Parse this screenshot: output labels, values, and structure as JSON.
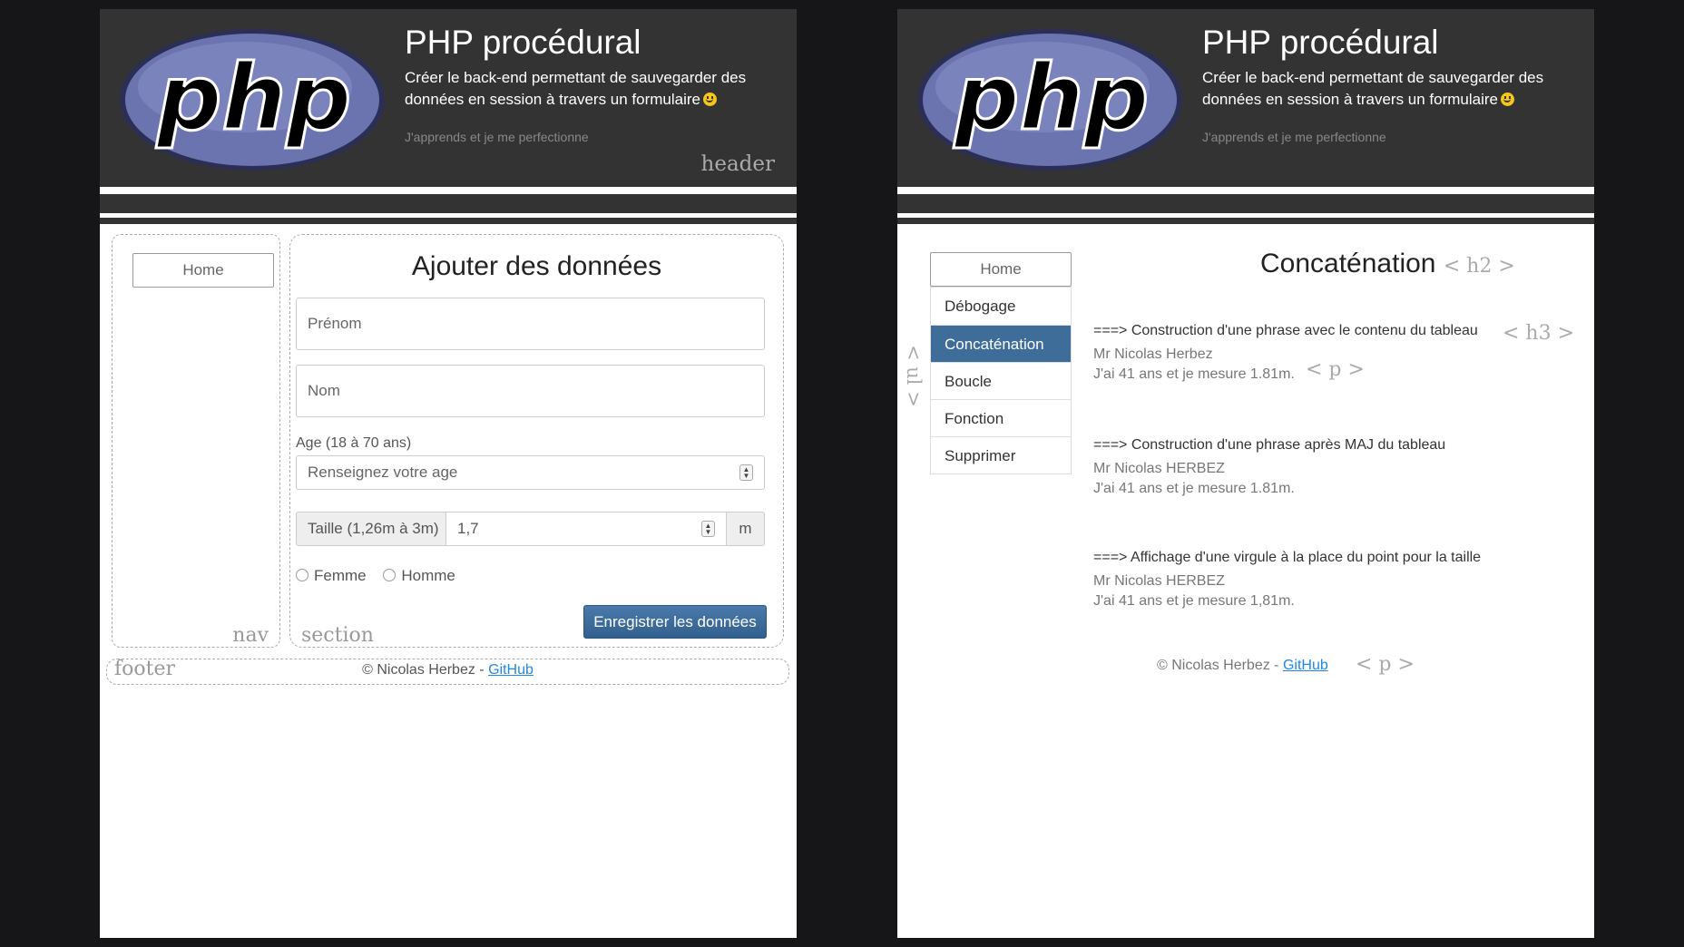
{
  "header": {
    "title": "PHP procédural",
    "subtitle": "Créer le back-end permettant de sauvegarder des données en session à travers un formulaire",
    "tagline": "J'apprends et je me perfectionne",
    "element_label": "header",
    "logo_text": "php"
  },
  "left": {
    "nav": {
      "home_label": "Home",
      "element_label": "nav"
    },
    "section": {
      "title": "Ajouter des données",
      "element_label": "section",
      "prenom_placeholder": "Prénom",
      "nom_placeholder": "Nom",
      "age_label": "Age (18 à 70 ans)",
      "age_placeholder": "Renseignez votre age",
      "taille_prefix": "Taille (1,26m à 3m)",
      "taille_value": "1,7",
      "taille_suffix": "m",
      "radio_femme": "Femme",
      "radio_homme": "Homme",
      "submit_label": "Enregistrer les données"
    },
    "footer": {
      "element_label": "footer",
      "copyright": "© Nicolas Herbez - ",
      "link": "GitHub"
    }
  },
  "right": {
    "home_label": "Home",
    "menu": [
      {
        "label": "Débogage",
        "active": false
      },
      {
        "label": "Concaténation",
        "active": true
      },
      {
        "label": "Boucle",
        "active": false
      },
      {
        "label": "Fonction",
        "active": false
      },
      {
        "label": "Supprimer",
        "active": false
      }
    ],
    "ul_label": "< ul >",
    "title": "Concaténation",
    "h2_label": "< h2 >",
    "h3_label": "< h3 >",
    "p_label": "< p >",
    "blocks": [
      {
        "heading": "===> Construction d'une phrase avec le contenu du tableau",
        "name": "Mr Nicolas Herbez",
        "text": "J'ai 41 ans et je mesure 1.81m."
      },
      {
        "heading": "===> Construction d'une phrase après MAJ du tableau",
        "name": "Mr Nicolas HERBEZ",
        "text": "J'ai 41 ans et je mesure 1.81m."
      },
      {
        "heading": "===> Affichage d'une virgule à la place du point pour la taille",
        "name": "Mr Nicolas HERBEZ",
        "text": "J'ai 41 ans et je mesure 1,81m."
      }
    ],
    "footer": {
      "copyright": "© Nicolas Herbez - ",
      "link": "GitHub",
      "p_label": "< p >"
    }
  },
  "colors": {
    "header_bg": "#333333",
    "active_menu": "#3f6d9a",
    "link": "#1e88e5",
    "page_bg": "#161618"
  }
}
